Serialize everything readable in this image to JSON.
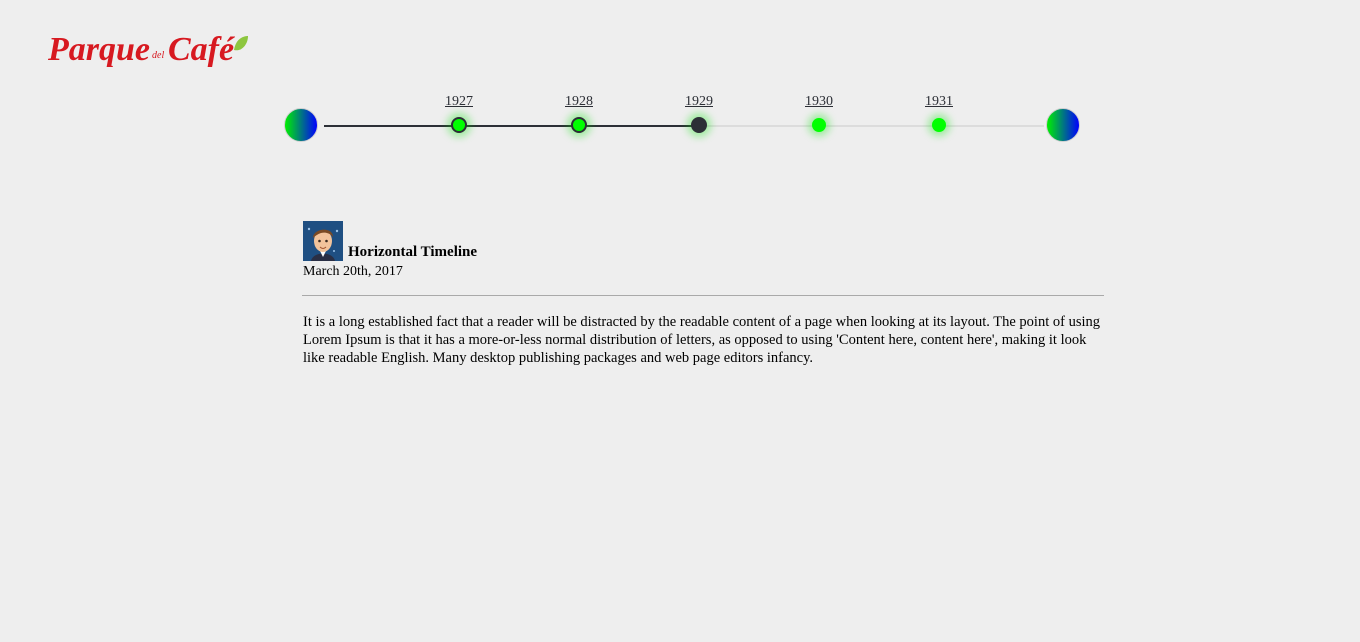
{
  "brand": {
    "logo_text": "Parque del Café",
    "logo_color": "#d71920",
    "leaf_color": "#8dc63f"
  },
  "timeline": {
    "events": [
      {
        "label": "1927",
        "state": "visited"
      },
      {
        "label": "1928",
        "state": "visited"
      },
      {
        "label": "1929",
        "state": "selected"
      },
      {
        "label": "1930",
        "state": "future"
      },
      {
        "label": "1931",
        "state": "future"
      }
    ],
    "prev_icon": "gradient-circle",
    "next_icon": "gradient-circle",
    "accent_color": "#00ff00",
    "track_color": "#2c2f36"
  },
  "post": {
    "title": "Horizontal Timeline",
    "date": "March 20th, 2017",
    "body": "It is a long established fact that a reader will be distracted by the readable content of a page when looking at its layout. The point of using Lorem Ipsum is that it has a more-or-less normal distribution of letters, as opposed to using 'Content here, content here', making it look like readable English. Many desktop publishing packages and web page editors infancy."
  }
}
